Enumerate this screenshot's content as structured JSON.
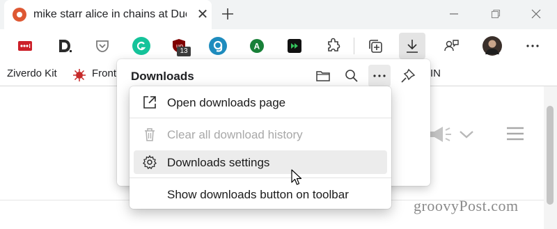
{
  "tab": {
    "title": "mike starr alice in chains at Duck",
    "close_glyph": "✕",
    "favicon": "duckduckgo-icon"
  },
  "window_controls": [
    "minimize-icon",
    "restore-icon",
    "close-icon"
  ],
  "toolbar": {
    "extensions": [
      {
        "name": "lastpass-icon",
        "color": "#cc2029"
      },
      {
        "name": "disconnect-icon",
        "color": "#2b2b2b"
      },
      {
        "name": "pocket-icon",
        "color": "#7a7a7a"
      },
      {
        "name": "grammarly-icon",
        "color": "#15c39a"
      },
      {
        "name": "ublock-icon",
        "color": "#800000"
      },
      {
        "name": "gravatar-icon",
        "color": "#1e8cbe"
      },
      {
        "name": "account-a-icon",
        "color": "#188038"
      },
      {
        "name": "media-player-icon",
        "color": "#111111"
      },
      {
        "name": "extensions-puzzle-icon",
        "color": "#3c3c3c"
      }
    ],
    "ublock_badge": "13",
    "collections_icon": "collections-icon",
    "downloads_icon": "download-icon",
    "feedback_icon": "feedback-icon",
    "profile_icon": "profile-avatar",
    "menu_icon": "more-icon"
  },
  "favorites": {
    "item1": "Ziverdo Kit",
    "item2": "Front",
    "item3_tail": "IN"
  },
  "downloads_panel": {
    "title": "Downloads",
    "buttons": [
      "folder-icon",
      "search-icon",
      "more-icon",
      "pin-icon"
    ]
  },
  "menu": {
    "open_page": "Open downloads page",
    "clear_history": "Clear all download history",
    "settings": "Downloads settings",
    "show_button": "Show downloads button on toolbar"
  },
  "watermark": "groovyPost.com",
  "colors": {
    "accent": "#de5833",
    "tab_strip": "#f1f3f4",
    "hover": "#ececec",
    "disabled_text": "#a8a8a8"
  }
}
